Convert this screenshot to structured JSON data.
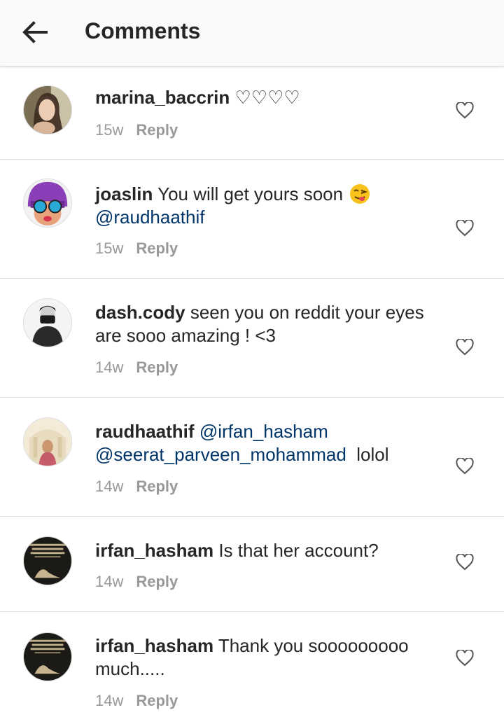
{
  "header": {
    "title": "Comments",
    "back_icon": "arrow-left-icon"
  },
  "colors": {
    "mention": "#003569",
    "meta": "#999999",
    "text": "#262626"
  },
  "reply_label": "Reply",
  "comments": [
    {
      "username": "marina_baccrin",
      "text": "♡♡♡♡",
      "time": "15w",
      "avatar": "woman-portrait"
    },
    {
      "username": "joaslin",
      "text": "You will get yours soon",
      "emoji": "face-savoring-icon",
      "mentions": [
        "@raudhaathif"
      ],
      "time": "15w",
      "avatar": "cartoon-girl-goggles"
    },
    {
      "username": "dash.cody",
      "text": "seen you on reddit your eyes are sooo amazing ! <3",
      "time": "14w",
      "avatar": "man-with-camera"
    },
    {
      "username": "raudhaathif",
      "mentions": [
        "@irfan_hasham",
        "@seerat_parveen_mohammad"
      ],
      "text": "lolol",
      "time": "14w",
      "avatar": "bride-portrait"
    },
    {
      "username": "irfan_hasham",
      "text": "Is that her account?",
      "time": "14w",
      "avatar": "prayer-quote"
    },
    {
      "username": "irfan_hasham",
      "text": "Thank you sooooooooo much.....",
      "time": "14w",
      "avatar": "prayer-quote"
    }
  ]
}
